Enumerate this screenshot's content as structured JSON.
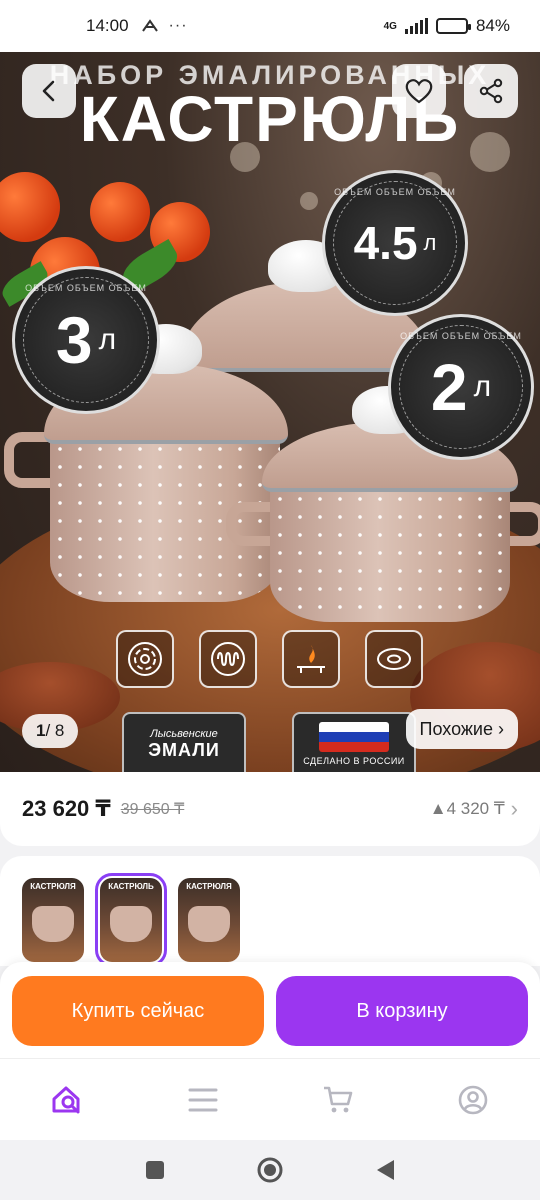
{
  "status_bar": {
    "time": "14:00",
    "network": "4G",
    "battery": "84%",
    "battery_level": 0.84,
    "icons": [
      "notification-icon",
      "more-icon",
      "signal-icon",
      "battery-icon"
    ]
  },
  "hero": {
    "title_small": "НАБОР ЭМАЛИРОВАННЫХ",
    "title_big": "КАСТРЮЛЬ",
    "volume_caption": "ОБЪЕМ ОБЪЕМ ОБЪЕМ",
    "volumes": [
      {
        "value": "4.5",
        "unit": "л"
      },
      {
        "value": "3",
        "unit": "л"
      },
      {
        "value": "2",
        "unit": "л"
      }
    ],
    "feature_icons": [
      "electric-stove-icon",
      "induction-stove-icon",
      "gas-stove-icon",
      "glass-ceramic-stove-icon"
    ],
    "brand_small": "Лысьвенские",
    "brand_big": "ЭМАЛИ",
    "origin": "СДЕЛАНО В РОССИИ",
    "flag_colors": [
      "#ffffff",
      "#1f3fb5",
      "#d52b1e"
    ],
    "counter_current": "1",
    "counter_total": "/ 8",
    "similar_label": "Похожие ›"
  },
  "price": {
    "current": "23 620 ₸",
    "old": "39 650 ₸",
    "bonus": "▲4 320 ₸",
    "chevron": "›"
  },
  "thumbnails": [
    {
      "label": "КАСТРЮЛЯ",
      "selected": false
    },
    {
      "label": "КАСТРЮЛЬ",
      "selected": true
    },
    {
      "label": "КАСТРЮЛЯ",
      "selected": false
    }
  ],
  "actions": {
    "buy_now": "Купить сейчас",
    "add_to_cart": "В корзину"
  },
  "colors": {
    "buy_now": "#ff7a1f",
    "add_to_cart": "#9b36f0",
    "accent": "#8a3ff5"
  },
  "bottom_nav": [
    "home-search-icon",
    "catalog-icon",
    "cart-icon",
    "profile-icon"
  ],
  "system_nav": [
    "recents-icon",
    "home-icon",
    "back-icon"
  ]
}
